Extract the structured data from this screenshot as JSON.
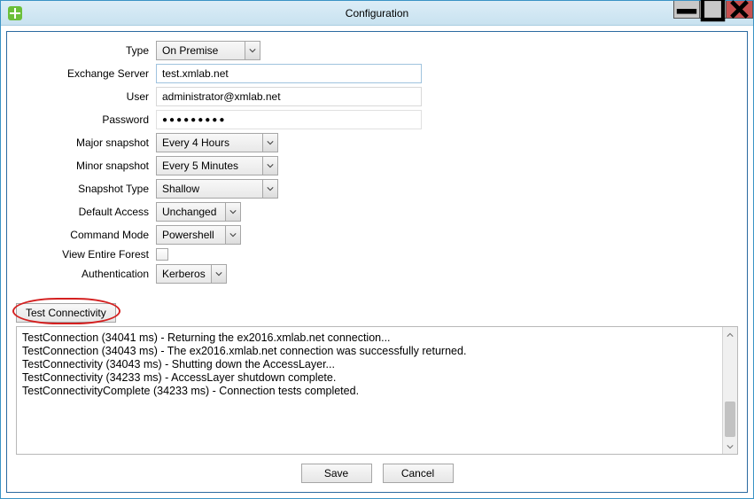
{
  "window": {
    "title": "Configuration"
  },
  "form": {
    "type_label": "Type",
    "type_value": "On Premise",
    "exchange_label": "Exchange Server",
    "exchange_value": "test.xmlab.net",
    "user_label": "User",
    "user_value": "administrator@xmlab.net",
    "password_label": "Password",
    "password_masked": "●●●●●●●●●",
    "major_label": "Major snapshot",
    "major_value": "Every 4 Hours",
    "minor_label": "Minor snapshot",
    "minor_value": "Every 5 Minutes",
    "snapshot_type_label": "Snapshot Type",
    "snapshot_type_value": "Shallow",
    "default_access_label": "Default Access",
    "default_access_value": "Unchanged",
    "command_mode_label": "Command Mode",
    "command_mode_value": "Powershell",
    "view_forest_label": "View Entire Forest",
    "view_forest_checked": false,
    "auth_label": "Authentication",
    "auth_value": "Kerberos"
  },
  "actions": {
    "test_connectivity": "Test Connectivity",
    "save": "Save",
    "cancel": "Cancel"
  },
  "log": {
    "lines": [
      "TestConnection (34041 ms) - Returning the ex2016.xmlab.net connection...",
      "TestConnection (34043 ms) - The ex2016.xmlab.net connection was successfully returned.",
      "TestConnectivity (34043 ms) - Shutting down the AccessLayer...",
      "TestConnectivity (34233 ms) - AccessLayer shutdown complete.",
      "TestConnectivityComplete (34233 ms) - Connection tests completed."
    ]
  }
}
